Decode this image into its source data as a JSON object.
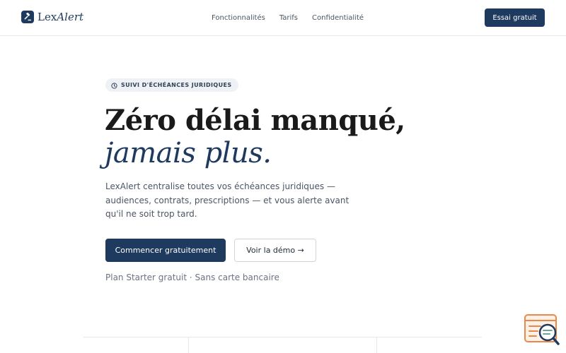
{
  "header": {
    "brand": {
      "part1": "Lex",
      "part2": "Alert"
    },
    "nav": [
      {
        "label": "Fonctionnalités"
      },
      {
        "label": "Tarifs"
      },
      {
        "label": "Confidentialité"
      }
    ],
    "cta_label": "Essai gratuit"
  },
  "hero": {
    "badge": {
      "icon": "clock-icon",
      "label": "SUIVI D'ÉCHÉANCES JURIDIQUES"
    },
    "title_line1": "Zéro délai manqué,",
    "title_line2": "jamais plus.",
    "lead": "LexAlert centralise toutes vos échéances juridiques — audiences, contrats, prescriptions — et vous alerte avant qu'il ne soit trop tard.",
    "primary_cta": "Commencer gratuitement",
    "secondary_cta": "Voir la démo →",
    "note": "Plan Starter gratuit · Sans carte bancaire"
  },
  "widget": {
    "icon": "search-document-icon"
  },
  "colors": {
    "brand": "#1e3a5f",
    "accent_orange": "#e8894a",
    "badge_bg": "#eef1f6"
  }
}
